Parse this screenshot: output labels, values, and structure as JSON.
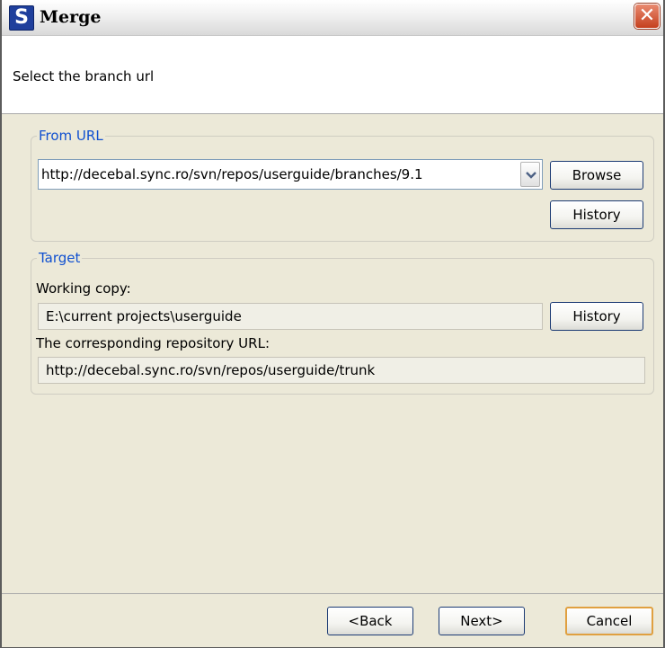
{
  "window": {
    "title": "Merge",
    "app_icon_letter": "S",
    "close_icon": "close-icon"
  },
  "header": {
    "instruction": "Select the branch url"
  },
  "from_url": {
    "legend": "From URL",
    "url_value": "http://decebal.sync.ro/svn/repos/userguide/branches/9.1",
    "browse_label": "Browse",
    "history_label": "History"
  },
  "target": {
    "legend": "Target",
    "working_copy_label": "Working copy:",
    "working_copy_value": "E:\\current projects\\userguide",
    "history_label": "History",
    "repo_url_label": "The corresponding repository URL:",
    "repo_url_value": "http://decebal.sync.ro/svn/repos/userguide/trunk"
  },
  "footer": {
    "back_label": "<Back",
    "next_label": "Next>",
    "cancel_label": "Cancel"
  },
  "colors": {
    "legend_blue": "#1050d0",
    "dialog_bg": "#ece9d8",
    "default_button_border": "#e0a040",
    "close_button_red": "#c5401e"
  }
}
